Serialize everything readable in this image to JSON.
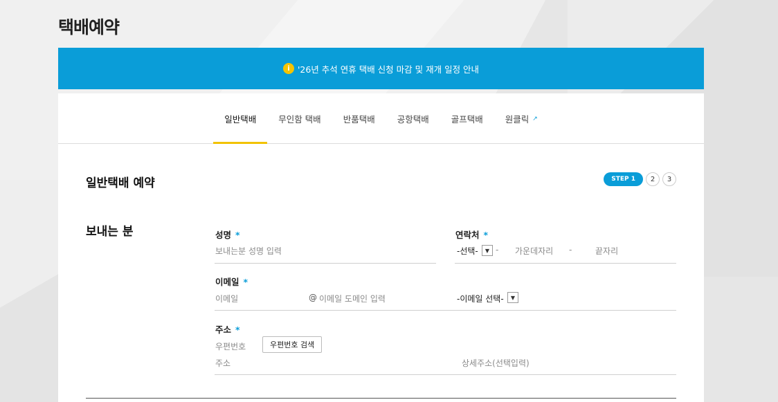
{
  "page_title": "택배예약",
  "notice": {
    "icon": "i",
    "text": "'26년 추석 연휴 택배 신청 마감 및 재개 일정 안내"
  },
  "tabs": [
    {
      "label": "일반택배",
      "active": true
    },
    {
      "label": "무인함 택배",
      "active": false
    },
    {
      "label": "반품택배",
      "active": false
    },
    {
      "label": "공항택배",
      "active": false
    },
    {
      "label": "골프택배",
      "active": false
    },
    {
      "label": "원클릭",
      "active": false,
      "external_icon": "external-link-icon"
    }
  ],
  "section_title": "일반택배 예약",
  "steps": {
    "active_label": "STEP 1",
    "others": [
      "2",
      "3"
    ]
  },
  "sender": {
    "title": "보내는 분",
    "name": {
      "label": "성명",
      "required_mark": "*",
      "placeholder": "보내는분 성명 입력"
    },
    "phone": {
      "label": "연락처",
      "required_mark": "*",
      "prefix_value": "-선택-",
      "sep1": "-",
      "middle_placeholder": "가운데자리",
      "sep2": "-",
      "last_placeholder": "끝자리"
    },
    "email": {
      "label": "이메일",
      "required_mark": "*",
      "id_placeholder": "이메일",
      "at": "@",
      "domain_placeholder": "이메일 도메인 입력",
      "domain_select": "-이메일 선택-"
    },
    "address": {
      "label": "주소",
      "required_mark": "*",
      "zip_placeholder": "우편번호",
      "zip_button": "우편번호 검색",
      "addr_placeholder": "주소",
      "detail_placeholder": "상세주소(선택입력)"
    }
  },
  "colors": {
    "accent": "#0a9dd8",
    "tab_underline": "#f2c200",
    "info_icon": "#f5c400"
  }
}
